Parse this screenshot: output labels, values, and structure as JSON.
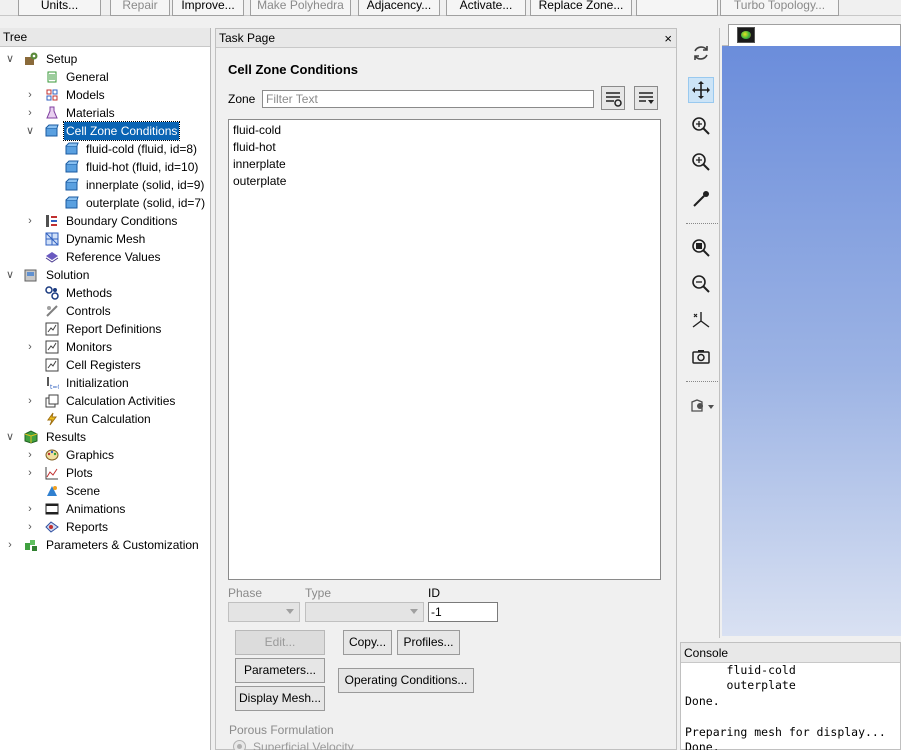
{
  "toolbar": {
    "units": "Units...",
    "repair": "Repair",
    "improve": "Improve...",
    "make_polyhedra": "Make Polyhedra",
    "adjacency": "Adjacency...",
    "activate": "Activate...",
    "replace_zone": "Replace Zone...",
    "turbo_topology": "Turbo Topology..."
  },
  "tree": {
    "header": "Tree",
    "items": {
      "setup": "Setup",
      "general": "General",
      "models": "Models",
      "materials": "Materials",
      "cell_zone_conditions": "Cell Zone Conditions",
      "fluid_cold": "fluid-cold (fluid, id=8)",
      "fluid_hot": "fluid-hot (fluid, id=10)",
      "innerplate": "innerplate (solid, id=9)",
      "outerplate": "outerplate (solid, id=7)",
      "boundary_conditions": "Boundary Conditions",
      "dynamic_mesh": "Dynamic Mesh",
      "reference_values": "Reference Values",
      "solution": "Solution",
      "methods": "Methods",
      "controls": "Controls",
      "report_definitions": "Report Definitions",
      "monitors": "Monitors",
      "cell_registers": "Cell Registers",
      "initialization": "Initialization",
      "calculation_activities": "Calculation Activities",
      "run_calculation": "Run Calculation",
      "results": "Results",
      "graphics": "Graphics",
      "plots": "Plots",
      "scene": "Scene",
      "animations": "Animations",
      "reports": "Reports",
      "parameters": "Parameters & Customization"
    }
  },
  "task_page": {
    "header": "Task Page",
    "close": "×",
    "title": "Cell Zone Conditions",
    "zone_label": "Zone",
    "zone_filter_placeholder": "Filter Text",
    "zones": [
      "fluid-cold",
      "fluid-hot",
      "innerplate",
      "outerplate"
    ],
    "phase_label": "Phase",
    "type_label": "Type",
    "id_label": "ID",
    "id_value": "-1",
    "buttons": {
      "edit": "Edit...",
      "copy": "Copy...",
      "profiles": "Profiles...",
      "parameters": "Parameters...",
      "operating_conditions": "Operating Conditions...",
      "display_mesh": "Display Mesh..."
    },
    "porous_formulation_label": "Porous Formulation",
    "superficial_velocity": "Superficial Velocity"
  },
  "console": {
    "header": "Console",
    "lines": [
      "      fluid-cold",
      "      outerplate",
      "Done.",
      "",
      "Preparing mesh for display...",
      "Done."
    ]
  },
  "icons": {
    "graphics_toolbar": [
      "rotate-icon",
      "pan-icon",
      "zoom-box-icon",
      "zoom-in-icon",
      "probe-icon",
      "fit-icon",
      "zoom-out-icon",
      "axes-icon",
      "camera-icon",
      "view-options-icon"
    ]
  },
  "colors": {
    "selection": "#0a64b4",
    "graphics_top": "#6b8ddb",
    "graphics_bottom": "#d9e1f2"
  }
}
